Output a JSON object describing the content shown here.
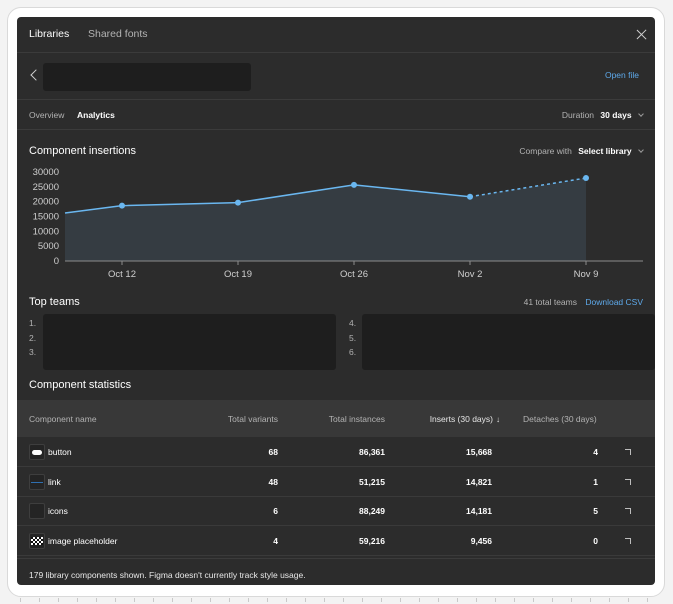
{
  "window": {
    "tabs": [
      {
        "label": "Libraries",
        "active": true
      },
      {
        "label": "Shared fonts",
        "active": false
      }
    ],
    "close_icon": "close-icon"
  },
  "file": {
    "back_icon": "chevron-left-icon",
    "open_file_label": "Open file"
  },
  "nav": {
    "tabs": [
      {
        "label": "Overview",
        "active": false
      },
      {
        "label": "Analytics",
        "active": true
      }
    ],
    "duration_label": "Duration",
    "duration_value": "30 days"
  },
  "insertions": {
    "title": "Component insertions",
    "compare_label": "Compare with",
    "compare_value": "Select library"
  },
  "top_teams": {
    "title": "Top teams",
    "total": "41 total teams",
    "download_label": "Download CSV",
    "ranks_left": [
      "1.",
      "2.",
      "3."
    ],
    "ranks_right": [
      "4.",
      "5.",
      "6."
    ]
  },
  "stats": {
    "title": "Component statistics",
    "columns": {
      "name": "Component name",
      "variants": "Total variants",
      "instances": "Total instances",
      "inserts": "Inserts (30 days)",
      "inserts_sort_icon": "↓",
      "detaches": "Detaches (30 days)"
    },
    "rows": [
      {
        "icon": "button-thumbnail",
        "name": "button",
        "variants": "68",
        "instances": "86,361",
        "inserts": "15,668",
        "detaches": "4"
      },
      {
        "icon": "link-thumbnail",
        "name": "link",
        "variants": "48",
        "instances": "51,215",
        "inserts": "14,821",
        "detaches": "1"
      },
      {
        "icon": "icons-thumbnail",
        "name": "icons",
        "variants": "6",
        "instances": "88,249",
        "inserts": "14,181",
        "detaches": "5"
      },
      {
        "icon": "image-placeholder-thumbnail",
        "name": "image placeholder",
        "variants": "4",
        "instances": "59,216",
        "inserts": "9,456",
        "detaches": "0"
      }
    ],
    "footer": "179 library components shown. Figma doesn't currently track style usage."
  },
  "colors": {
    "panel_bg": "#2c2c2c",
    "accent_line": "#6ab7f0",
    "link": "#5ea9ea",
    "area_fill": "#353c42"
  },
  "chart_data": {
    "type": "area",
    "title": "Component insertions",
    "xlabel": "",
    "ylabel": "",
    "categories": [
      "Oct 12",
      "Oct 19",
      "Oct 26",
      "Nov 2",
      "Nov 9"
    ],
    "series": [
      {
        "name": "Component insertions",
        "values": [
          18500,
          19500,
          25500,
          21500,
          27800
        ]
      }
    ],
    "leading_value_before_first": 16000,
    "projected_from_index": 3,
    "yticks": [
      0,
      5000,
      10000,
      15000,
      20000,
      25000,
      30000
    ],
    "ylim": [
      0,
      30000
    ],
    "grid": false,
    "legend": "none"
  }
}
